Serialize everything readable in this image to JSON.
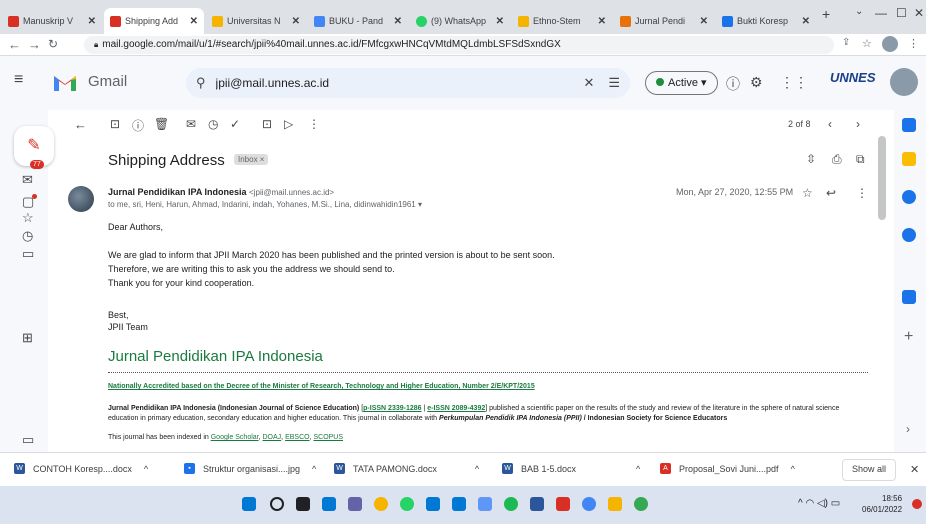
{
  "browser": {
    "tabs": [
      {
        "label": "Manuskrip V",
        "color": "#d93025"
      },
      {
        "label": "Shipping Add",
        "color": "#d93025"
      },
      {
        "label": "Universitas N",
        "color": "#f4b400"
      },
      {
        "label": "BUKU - Pand",
        "color": "#4285f4"
      },
      {
        "label": "(9) WhatsApp",
        "color": "#25d366"
      },
      {
        "label": "Ethno-Stem",
        "color": "#f4b400"
      },
      {
        "label": "Jurnal Pendi",
        "color": "#e8710a"
      },
      {
        "label": "Bukti Koresp",
        "color": "#1a73e8"
      }
    ],
    "new_tab_label": "+",
    "url": "mail.google.com/mail/u/1/#search/jpii%40mail.unnes.ac.id/FMfcgxwHNCqVMtdMQLdmbLSFSdSxndGX"
  },
  "gmail": {
    "app_name": "Gmail",
    "search_value": "jpii@mail.unnes.ac.id",
    "status": "Active",
    "brand_logo": "UNNES",
    "badge_count": "77",
    "pager": "2 of 8"
  },
  "email": {
    "subject": "Shipping Address",
    "label_chip": "Inbox ×",
    "sender_name": "Jurnal Pendidikan IPA Indonesia",
    "sender_email": "<jpii@mail.unnes.ac.id>",
    "recipients": "to me, sri, Heni, Harun, Ahmad, Indarini, indah, Yohanes, M.Si., Lina, didinwahidin1961 ▾",
    "date": "Mon, Apr 27, 2020, 12:55 PM",
    "greeting": "Dear Authors,",
    "line1": "We are glad to inform that JPII March 2020 has been published and the printed version is about to be sent soon.",
    "line2": "Therefore, we are writing this to ask you the address we should send to.",
    "line3": "Thank you for your kind cooperation.",
    "closing": "Best,",
    "signature": "JPII Team",
    "journal_title": "Jurnal Pendidikan IPA Indonesia",
    "accreditation": "Nationally Accredited based on the Decree of the Minister of Research, Technology and Higher Education, Number 2/E/KPT/2015",
    "para_bold": "Jurnal Pendidikan IPA Indonesia (Indonesian Journal of Science Education)",
    "pissn": "p-ISSN 2339-1286",
    "sep": " | ",
    "eissn": "e-ISSN 2089-4392",
    "para_rest": " published a scientific paper on the results of the study and review of the literature in the sphere of natural science education in primary education, secondary education and higher education. This journal in collaborate with ",
    "para_italic": "Perkumpulan Pendidik IPA Indonesia (PPII)",
    "para_end": " / Indonesian Society for Science Educators",
    "indexed_prefix": "This journal has been indexed in ",
    "index1": "Google Scholar",
    "index2": "DOAJ",
    "index3": "EBSCO",
    "index4": "SCOPUS"
  },
  "downloads": [
    {
      "name": "CONTOH Koresp....docx",
      "color": "#2b579a",
      "icon": "W"
    },
    {
      "name": "Struktur organisasi....jpg",
      "color": "#1a73e8",
      "icon": "▪"
    },
    {
      "name": "TATA PAMONG.docx",
      "color": "#2b579a",
      "icon": "W"
    },
    {
      "name": "BAB 1-5.docx",
      "color": "#2b579a",
      "icon": "W"
    },
    {
      "name": "Proposal_Sovi Juni....pdf",
      "color": "#d93025",
      "icon": "A"
    }
  ],
  "downloads_show_all": "Show all",
  "taskbar": {
    "time": "18:56",
    "date": "06/01/2022"
  }
}
